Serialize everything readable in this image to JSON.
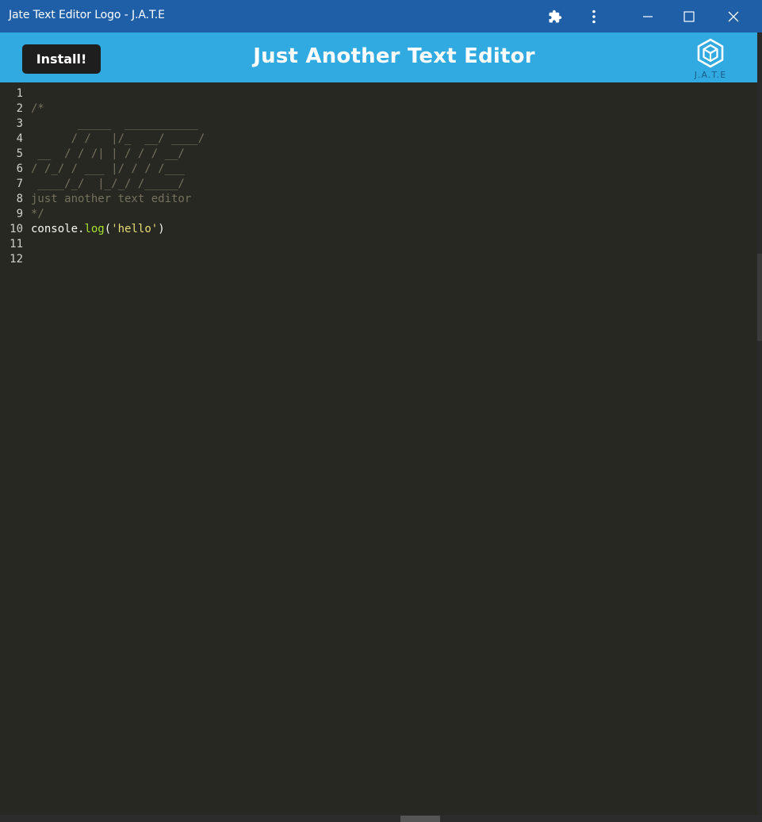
{
  "window": {
    "title": "Jate Text Editor Logo - J.A.T.E",
    "title_bar_color": "#1f5fa8",
    "controls": [
      "extensions-icon",
      "more-vert-icon",
      "minimize-icon",
      "maximize-icon",
      "close-icon"
    ]
  },
  "header": {
    "install_label": "Install!",
    "title": "Just Another Text Editor",
    "logo_text": "J.A.T.E",
    "background_color": "#31a9e1"
  },
  "editor": {
    "background_color": "#272822",
    "line_numbers": [
      "1",
      "2",
      "3",
      "4",
      "5",
      "6",
      "7",
      "8",
      "9",
      "10",
      "11",
      "12"
    ],
    "lines": [
      "",
      "/*",
      "       _____  ___________",
      "      / /   |/_  __/ ____/",
      " __  / / /| | / / / __/",
      "/ /_/ / ___ |/ / / /___",
      " ____/_/  |_/_/ /_____/",
      "just another text editor",
      "*/",
      "",
      "",
      ""
    ],
    "code_line_10": {
      "object": "console",
      "dot": ".",
      "method": "log",
      "open_paren": "(",
      "string": "'hello'",
      "close_paren": ")"
    }
  }
}
